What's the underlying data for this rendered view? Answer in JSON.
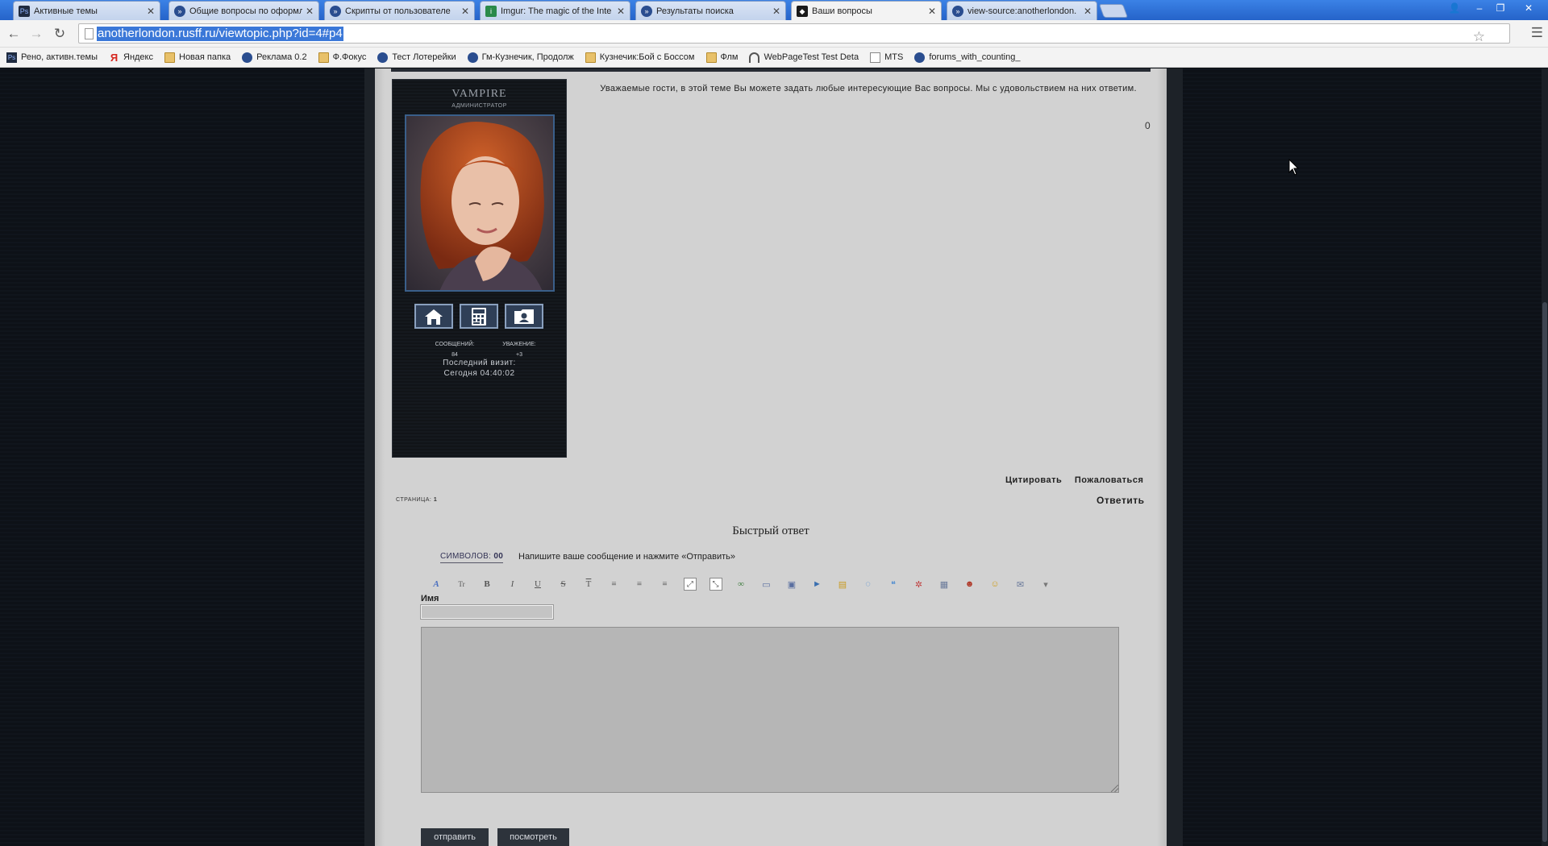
{
  "browser": {
    "tabs": [
      {
        "label": "Активные темы",
        "icon": "photoshop",
        "active": false
      },
      {
        "label": "Общие вопросы по оформл",
        "icon": "rusff",
        "active": false
      },
      {
        "label": "Скрипты от пользователе",
        "icon": "rusff",
        "active": false
      },
      {
        "label": "Imgur: The magic of the Inte",
        "icon": "imgur",
        "active": false
      },
      {
        "label": "Результаты поиска",
        "icon": "rusff",
        "active": false
      },
      {
        "label": "Ваши вопросы",
        "icon": "site",
        "active": true
      },
      {
        "label": "view-source:anotherlondon.",
        "icon": "rusff",
        "active": false
      }
    ],
    "url": "anotherlondon.rusff.ru/viewtopic.php?id=4#p4",
    "bookmarks": [
      {
        "label": "Рено, активн.темы",
        "icon": "photoshop"
      },
      {
        "label": "Яндекс",
        "icon": "yandex"
      },
      {
        "label": "Новая папка",
        "icon": "folder"
      },
      {
        "label": "Реклама 0.2",
        "icon": "rusff"
      },
      {
        "label": "Ф.Фокус",
        "icon": "folder"
      },
      {
        "label": "Тест Лотерейки",
        "icon": "rusff"
      },
      {
        "label": "Гм-Кузнечик, Продолж",
        "icon": "rusff"
      },
      {
        "label": "Кузнечик:Бой с Боссом",
        "icon": "folder"
      },
      {
        "label": "Флм",
        "icon": "folder"
      },
      {
        "label": "WebPageTest Test Deta",
        "icon": "speed"
      },
      {
        "label": "MTS",
        "icon": "doc"
      },
      {
        "label": "forums_with_counting_",
        "icon": "rusff"
      }
    ]
  },
  "profile": {
    "name": "VAMPIRE",
    "role": "АДМИНИСТРАТОР",
    "stats": [
      {
        "label": "СООБЩЕНИЙ:",
        "value": "84"
      },
      {
        "label": "УВАЖЕНИЕ:",
        "value": "+3"
      }
    ],
    "last_visit_label": "Последний визит:",
    "last_visit_value": "Сегодня 04:40:02",
    "buttons": [
      "home-icon",
      "calculator-icon",
      "contact-card-icon"
    ]
  },
  "post": {
    "text": "Уважаемые гости, в этой теме Вы можете задать любые интересующие Вас вопросы. Мы с удовольствием на них ответим.",
    "counter": "0",
    "actions": [
      "Цитировать",
      "Пожаловаться"
    ]
  },
  "pagination": {
    "label": "СТРАНИЦА:",
    "current": "1"
  },
  "reply_link": "Ответить",
  "quick_reply": {
    "title": "Быстрый ответ",
    "char_label": "СИМВОЛОВ:",
    "char_count": "00",
    "hint": "Напишите ваше сообщение и нажмите «Отправить»",
    "name_label": "Имя",
    "name_value": "",
    "message_value": "",
    "submit_label": "отправить",
    "preview_label": "посмотреть"
  },
  "colors": {
    "page_bg": "#0c1016",
    "forum_bg": "#d2d2d2",
    "profile_bg": "#111418",
    "button_bg": "#2d333b"
  }
}
